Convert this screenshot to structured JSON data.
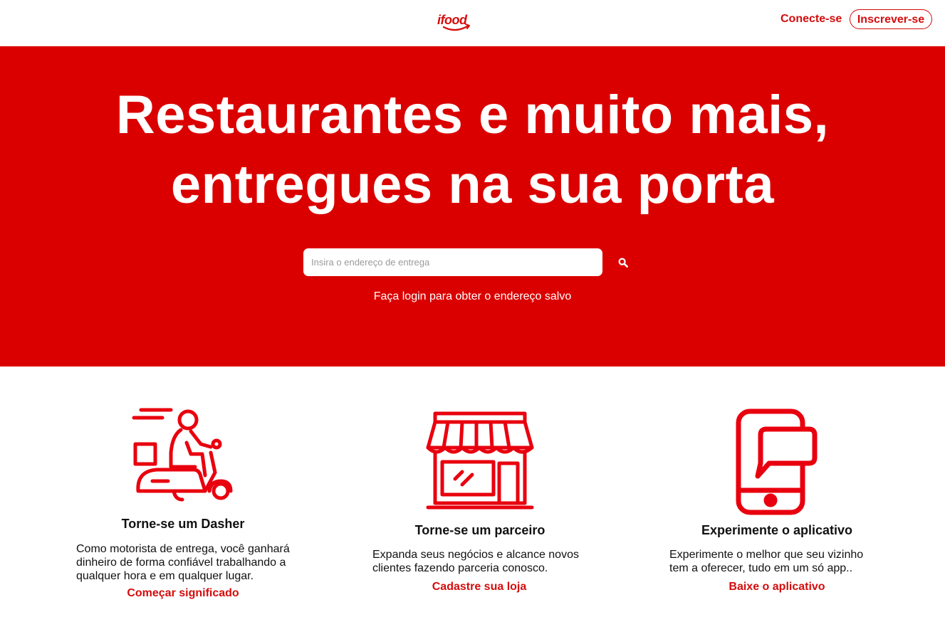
{
  "header": {
    "logo_text": "ifood",
    "login_label": "Conecte-se",
    "signup_label": "Inscrever-se"
  },
  "hero": {
    "title_line1": "Restaurantes e muito mais,",
    "title_line2": "entregues na sua porta",
    "search_placeholder": "Insira o endereço de entrega",
    "saved_address_link": "Faça login para obter o endereço salvo"
  },
  "features": [
    {
      "icon": "delivery-scooter-icon",
      "title": "Torne-se um Dasher",
      "text": "Como motorista de entrega, você ganhará dinheiro de forma confiável trabalhando a qualquer hora e em qualquer lugar.",
      "link": "Começar significado"
    },
    {
      "icon": "storefront-icon",
      "title": "Torne-se um parceiro",
      "text": "Expanda seus negócios e alcance novos clientes fazendo parceria conosco.",
      "link": "Cadastre sua loja"
    },
    {
      "icon": "phone-app-icon",
      "title": "Experimente o aplicativo",
      "text": "Experimente o melhor que seu vizinho tem a oferecer, tudo em um só app..",
      "link": "Baixe o aplicativo"
    }
  ],
  "colors": {
    "brand_red": "#db0000",
    "link_red": "#d50c0c",
    "white": "#ffffff"
  }
}
